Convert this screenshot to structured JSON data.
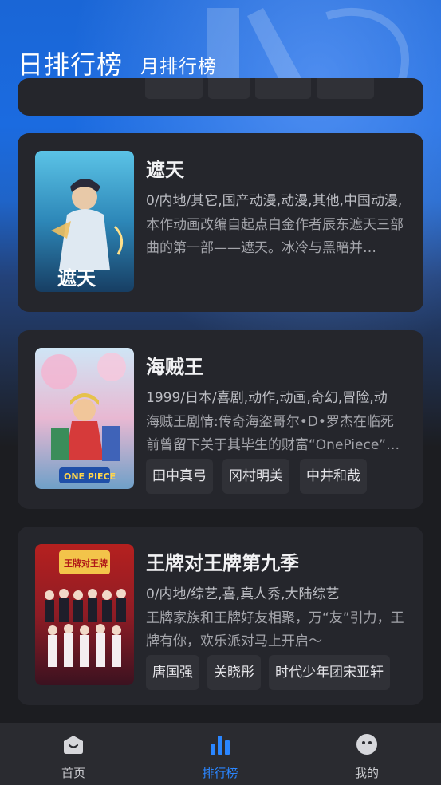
{
  "header": {
    "tabs": [
      {
        "label": "日排行榜",
        "active": true
      },
      {
        "label": "月排行榜",
        "active": false
      }
    ]
  },
  "list": [
    {
      "title": "遮天",
      "meta": "0/内地/其它,国产动漫,动漫,其他,中国动漫,",
      "description": "本作动画改编自起点白金作者辰东遮天三部曲的第一部——遮天。冰冷与黑暗并…",
      "poster_caption": "遮天",
      "tags": []
    },
    {
      "title": "海贼王",
      "meta": "1999/日本/喜剧,动作,动画,奇幻,冒险,动",
      "description": "海贼王剧情:传奇海盗哥尔•D•罗杰在临死前曾留下关于其毕生的财富“OnePiece”…",
      "poster_caption": "ONE PIECE",
      "tags": [
        "田中真弓",
        "冈村明美",
        "中井和哉"
      ]
    },
    {
      "title": "王牌对王牌第九季",
      "meta": "0/内地/综艺,喜,真人秀,大陆综艺",
      "description": "王牌家族和王牌好友相聚，万“友”引力，王牌有你，欢乐派对马上开启～",
      "poster_caption": "王牌对王牌",
      "tags": [
        "唐国强",
        "关晓彤",
        "时代少年团宋亚轩"
      ]
    }
  ],
  "bottom_nav": [
    {
      "label": "首页",
      "icon": "home-icon",
      "active": false
    },
    {
      "label": "排行榜",
      "icon": "chart-icon",
      "active": true
    },
    {
      "label": "我的",
      "icon": "profile-icon",
      "active": false
    }
  ],
  "colors": {
    "accent": "#2a86ff",
    "card_bg": "#25262c",
    "header_blue": "#1b6be0"
  }
}
